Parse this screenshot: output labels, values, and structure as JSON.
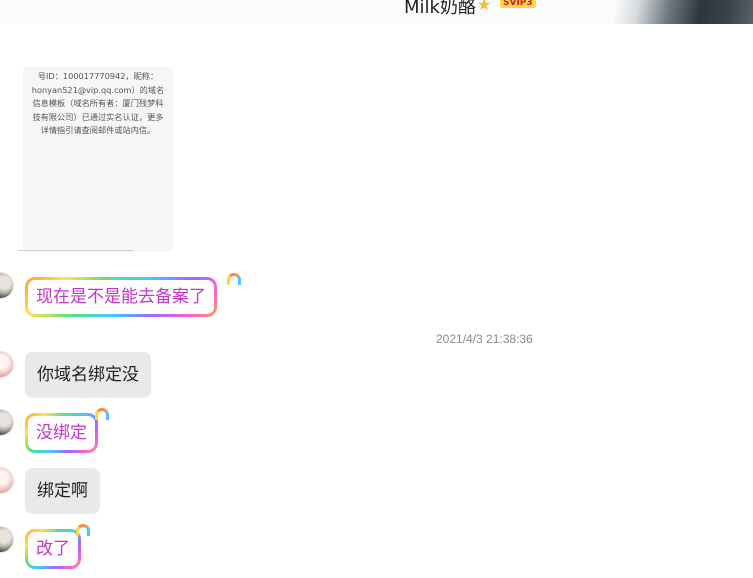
{
  "header": {
    "contact_name": "Milk奶酪",
    "vip_badge": "SVIP3",
    "star_icon": "star-icon"
  },
  "image_card": {
    "text": "号ID：100017770942，昵称：honyan521@vip.qq.com）的域名信息模板（域名所有者：厦门残梦科技有限公司）已通过实名认证，更多详情指引请查阅邮件或站内信。"
  },
  "messages": [
    {
      "text": "现在是不是能去备案了",
      "sender": "me",
      "style": "rainbow"
    },
    {
      "text": "你域名绑定没",
      "sender": "other",
      "style": "plain"
    },
    {
      "text": "没绑定",
      "sender": "me",
      "style": "rainbow"
    },
    {
      "text": "绑定啊",
      "sender": "other",
      "style": "plain"
    },
    {
      "text": "改了",
      "sender": "me",
      "style": "rainbow"
    }
  ],
  "timestamp": "2021/4/3 21:38:36",
  "colors": {
    "fancy_text": "#c236c9",
    "plain_bubble": "#e9e9e9",
    "timestamp": "#8a8a8a"
  }
}
